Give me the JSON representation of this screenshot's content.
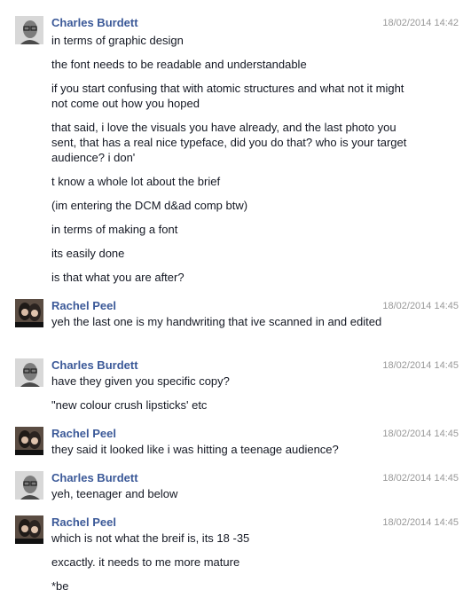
{
  "conversation": [
    {
      "sender": "Charles Burdett",
      "avatar": "charles-avatar",
      "timestamp": "18/02/2014 14:42",
      "messages": [
        "in terms of graphic design",
        "the font needs to be readable and understandable",
        "if you start confusing that with atomic structures and what not it might not come out how you hoped",
        "that said, i love the visuals you have already, and the last photo you sent, that has a real nice typeface, did you do that? who is your target audience? i don'",
        "t know a whole lot about the brief",
        "(im entering the DCM d&ad comp btw)",
        "in terms of making a font",
        "its easily done",
        "is that what you are after?"
      ]
    },
    {
      "sender": "Rachel Peel",
      "avatar": "rachel-avatar",
      "timestamp": "18/02/2014 14:45",
      "messages": [
        "yeh the last one is my handwriting that ive scanned in and edited"
      ]
    },
    {
      "sender": "Charles Burdett",
      "avatar": "charles-avatar",
      "timestamp": "18/02/2014 14:45",
      "messages": [
        "have they given you specific copy?",
        "\"new colour crush lipsticks' etc"
      ]
    },
    {
      "sender": "Rachel Peel",
      "avatar": "rachel-avatar",
      "timestamp": "18/02/2014 14:45",
      "messages": [
        "they said it looked like i was hitting a teenage audience?"
      ]
    },
    {
      "sender": "Charles Burdett",
      "avatar": "charles-avatar",
      "timestamp": "18/02/2014 14:45",
      "messages": [
        "yeh, teenager and below"
      ]
    },
    {
      "sender": "Rachel Peel",
      "avatar": "rachel-avatar",
      "timestamp": "18/02/2014 14:45",
      "messages": [
        "which is not what the breif is, its 18 -35",
        "excactly. it needs to me more mature",
        "*be"
      ]
    }
  ],
  "colors": {
    "sender": "#3b5998",
    "timestamp": "#999999",
    "text": "#141823"
  }
}
